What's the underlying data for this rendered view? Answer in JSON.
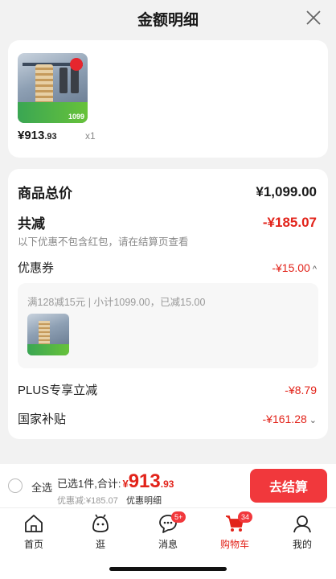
{
  "header": {
    "title": "金额明细"
  },
  "product": {
    "price_main": "¥913",
    "price_decimal": ".93",
    "quantity": "x1"
  },
  "summary": {
    "total_label": "商品总价",
    "total_value": "¥1,099.00",
    "discount_label": "共减",
    "discount_value": "-¥185.07",
    "discount_note": "以下优惠不包含红包，请在结算页查看",
    "coupon_label": "优惠券",
    "coupon_value": "-¥15.00",
    "coupon_detail": "满128减15元 | 小计1099.00，已减15.00",
    "plus_label": "PLUS专享立减",
    "plus_value": "-¥8.79",
    "subsidy_label": "国家补贴",
    "subsidy_value": "-¥161.28"
  },
  "footer": {
    "select_all": "全选",
    "selected_prefix": "已选1件,合计:",
    "yen": "¥",
    "total_main": "913",
    "total_decimal": ".93",
    "saved": "优惠减:¥185.07",
    "detail_link": "优惠明细",
    "checkout": "去结算"
  },
  "tabbar": {
    "items": [
      {
        "label": "首页",
        "icon": "home-icon"
      },
      {
        "label": "逛",
        "icon": "browse-icon"
      },
      {
        "label": "消息",
        "icon": "message-icon",
        "badge": "5+"
      },
      {
        "label": "购物车",
        "icon": "cart-icon",
        "badge": "34",
        "active": true
      },
      {
        "label": "我的",
        "icon": "profile-icon"
      }
    ]
  },
  "colors": {
    "accent": "#e2231a",
    "button": "#f1383c"
  }
}
